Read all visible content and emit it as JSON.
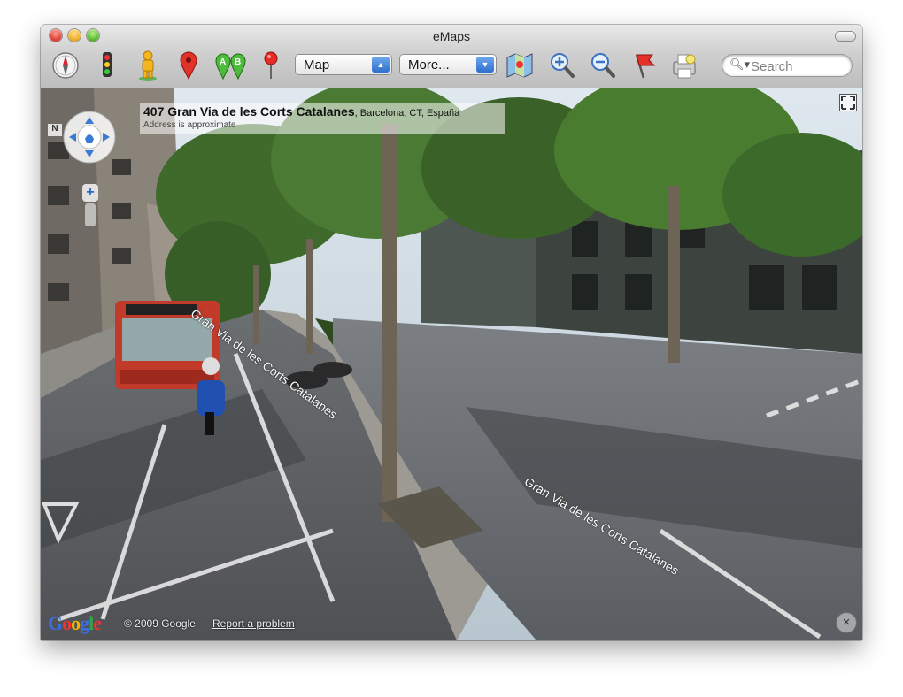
{
  "window": {
    "title": "eMaps"
  },
  "toolbar": {
    "icons": [
      "compass-icon",
      "traffic-light-icon",
      "pegman-icon",
      "pin-icon",
      "directions-ab-icon",
      "pushpin-icon",
      "map-view-icon",
      "zoom-in-icon",
      "zoom-out-icon",
      "flag-icon",
      "print-icon"
    ],
    "map_type": "Map",
    "more_label": "More...",
    "search_placeholder": "Search"
  },
  "street_view": {
    "address_number": "407",
    "address_street": "Gran Via de les Corts Catalanes",
    "address_city": ", Barcelona, CT, España",
    "address_note": "Address is approximate",
    "road_label_1": "Gran Via de les Corts Catalanes",
    "road_label_2": "Gran Via de les Corts Catalanes",
    "compass_letter": "N",
    "zoom_plus": "+",
    "google_logo": "Google",
    "copyright": "© 2009 Google",
    "report_link": "Report a problem",
    "close_glyph": "×"
  },
  "colors": {
    "accent": "#2f6fcd"
  }
}
